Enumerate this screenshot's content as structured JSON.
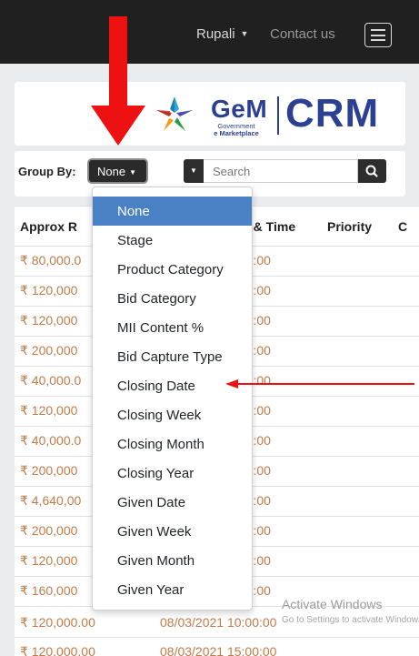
{
  "navbar": {
    "user_name": "Rupali",
    "contact_link": "Contact us"
  },
  "brand": {
    "gem_text": "GeM",
    "gem_subtitle_line1": "Government",
    "gem_subtitle_line2": "e Marketplace",
    "crm_text": "CRM",
    "color": "#2b3f93"
  },
  "filters": {
    "group_by_label": "Group By:",
    "group_by_value": "None",
    "search_placeholder": "Search"
  },
  "table": {
    "headers": [
      "Approx R",
      "e & Time",
      "Priority",
      "C"
    ],
    "rows": [
      {
        "amount": "₹ 80,000.0",
        "time": ":00:00"
      },
      {
        "amount": "₹ 120,000",
        "time": ":00:00"
      },
      {
        "amount": "₹ 120,000",
        "time": ":00:00"
      },
      {
        "amount": "₹ 200,000",
        "time": ":00:00"
      },
      {
        "amount": "₹ 40,000.0",
        "time": ":00:00"
      },
      {
        "amount": "₹ 120,000",
        "time": ":00:00"
      },
      {
        "amount": "₹ 40,000.0",
        "time": ":00:00"
      },
      {
        "amount": "₹ 200,000",
        "time": ":00:00"
      },
      {
        "amount": "₹ 4,640,00",
        "time": ":00:00"
      },
      {
        "amount": "₹ 200,000",
        "time": ":00:00"
      },
      {
        "amount": "₹ 120,000",
        "time": ":00:00"
      },
      {
        "amount": "₹ 160,000",
        "time": ":00:00"
      },
      {
        "amount": "₹ 120,000.00",
        "date": "08/03/2021 10:00:00"
      },
      {
        "amount": "₹ 120,000.00",
        "date": "08/03/2021 15:00:00"
      }
    ],
    "value_color": "#c27b48"
  },
  "group_by_menu": {
    "items": [
      "None",
      "Stage",
      "Product Category",
      "Bid Category",
      "MII Content %",
      "Bid Capture Type",
      "Closing Date",
      "Closing Week",
      "Closing Month",
      "Closing Year",
      "Given Date",
      "Given Week",
      "Given Month",
      "Given Year"
    ],
    "active_color": "#4a80c4"
  },
  "watermark": {
    "line1": "Activate Windows",
    "line2": "Go to Settings to activate Windows."
  },
  "annotation_color": "#ee1111"
}
